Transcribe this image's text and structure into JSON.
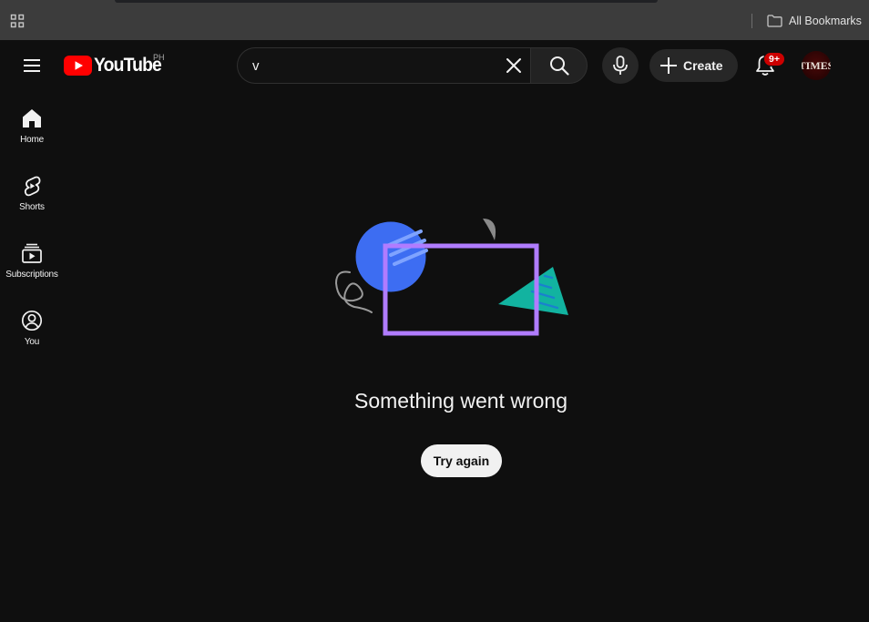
{
  "browser": {
    "bookmarks_bar": {
      "apps_icon": "apps-grid-icon",
      "all_bookmarks_label": "All Bookmarks",
      "folder_icon": "folder-icon"
    }
  },
  "masthead": {
    "menu_icon": "hamburger-menu-icon",
    "logo_text": "YouTube",
    "region_code": "PH",
    "search": {
      "value": "v",
      "placeholder": "Search"
    },
    "clear_icon": "close-icon",
    "search_icon": "search-icon",
    "mic_icon": "microphone-icon",
    "create_label": "Create",
    "notifications_badge": "9+",
    "avatar_text": "TIMES"
  },
  "sidebar": {
    "items": [
      {
        "label": "Home",
        "icon": "home-icon"
      },
      {
        "label": "Shorts",
        "icon": "shorts-icon"
      },
      {
        "label": "Subscriptions",
        "icon": "subscriptions-icon"
      },
      {
        "label": "You",
        "icon": "account-icon"
      }
    ]
  },
  "error": {
    "message": "Something went wrong",
    "retry_label": "Try again"
  },
  "colors": {
    "background": "#0f0f0f",
    "brand_red": "#ff0000",
    "badge_red": "#cc0000",
    "illustration_blue": "#3d6df2",
    "illustration_purple": "#b07cff",
    "illustration_teal": "#12b3a0"
  }
}
